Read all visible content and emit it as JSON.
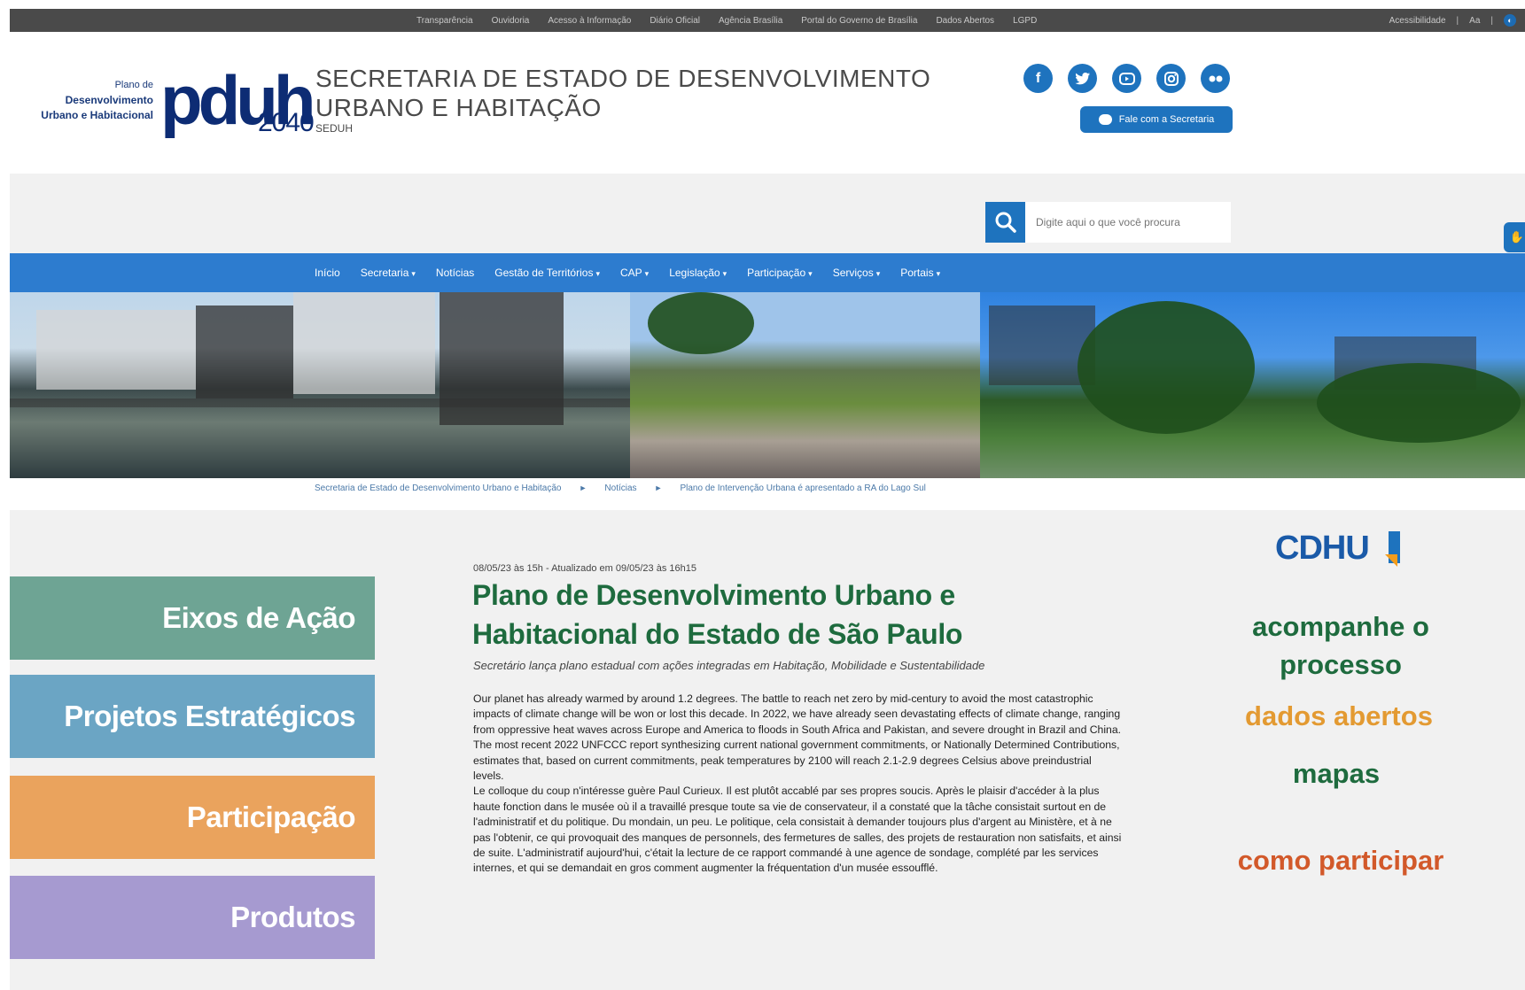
{
  "govbar": {
    "links": [
      "Transparência",
      "Ouvidoria",
      "Acesso à Informação",
      "Diário Oficial",
      "Agência Brasília",
      "Portal do Governo de Brasília",
      "Dados Abertos",
      "LGPD"
    ],
    "accessibility": "Acessibilidade",
    "font_size": "Aa"
  },
  "logo": {
    "line1": "Plano de",
    "line2": "Desenvolvimento",
    "line3": "Urbano e Habitacional",
    "brand": "pduh",
    "year": "2040"
  },
  "header": {
    "title_line1": "SECRETARIA DE ESTADO DE DESENVOLVIMENTO",
    "title_line2": "URBANO E HABITAÇÃO",
    "abbr": "SEDUH",
    "contact_button": "Fale com a Secretaria",
    "social_icons": [
      "facebook-icon",
      "twitter-icon",
      "youtube-icon",
      "instagram-icon",
      "flickr-icon"
    ]
  },
  "search": {
    "placeholder": "Digite aqui o que você procura"
  },
  "nav": {
    "items": [
      {
        "label": "Início",
        "dropdown": false
      },
      {
        "label": "Secretaria",
        "dropdown": true
      },
      {
        "label": "Notícias",
        "dropdown": false
      },
      {
        "label": "Gestão de Territórios",
        "dropdown": true
      },
      {
        "label": "CAP",
        "dropdown": true
      },
      {
        "label": "Legislação",
        "dropdown": true
      },
      {
        "label": "Participação",
        "dropdown": true
      },
      {
        "label": "Serviços",
        "dropdown": true
      },
      {
        "label": "Portais",
        "dropdown": true
      }
    ]
  },
  "breadcrumb": {
    "items": [
      "Secretaria de Estado de Desenvolvimento Urbano e Habitação",
      "Notícias",
      "Plano de Intervenção Urbana é apresentado a RA do Lago Sul"
    ]
  },
  "sidebar": {
    "tiles": [
      "Eixos de Ação",
      "Projetos Estratégicos",
      "Participação",
      "Produtos"
    ]
  },
  "article": {
    "meta": "08/05/23 às 15h - Atualizado em 09/05/23 às 16h15",
    "title": "Plano de Desenvolvimento Urbano e Habitacional do Estado de São Paulo",
    "subtitle": "Secretário lança plano estadual com ações integradas em Habitação, Mobilidade e Sustentabilidade",
    "paragraphs": [
      "Our planet has already warmed by around 1.2 degrees. The battle to reach net zero by mid-century to avoid the most catastrophic impacts of climate change will be won or lost this decade. In 2022, we have already seen devastating effects of climate change, ranging from oppressive heat waves across Europe and America to floods in South Africa and Pakistan, and severe drought in Brazil and China.",
      "The most recent 2022 UNFCCC report synthesizing current national government commitments, or Nationally Determined Contributions, estimates that, based on current commitments, peak temperatures by 2100 will reach 2.1-2.9 degrees Celsius above preindustrial levels.",
      "Le colloque du coup n'intéresse guère Paul Curieux. Il est plutôt accablé par ses propres soucis. Après le plaisir d'accéder à la plus haute fonction dans le musée où il a travaillé presque toute sa vie de conservateur, il a constaté que la tâche consistait surtout en de l'administratif et du politique. Du mondain, un peu. Le politique, cela consistait à demander toujours plus d'argent au Ministère, et à ne pas l'obtenir, ce qui provoquait des manques de personnels, des fermetures de salles, des projets de restauration non satisfaits, et ainsi de suite. L'administratif aujourd'hui, c'était la lecture de ce rapport commandé à une agence de sondage, complété par les services internes, et qui se demandait en gros comment augmenter la fréquentation d'un musée essoufflé."
    ]
  },
  "right": {
    "brand": "CDHU",
    "links": [
      "acompanhe o processo",
      "dados abertos",
      "mapas",
      "como participar"
    ]
  }
}
